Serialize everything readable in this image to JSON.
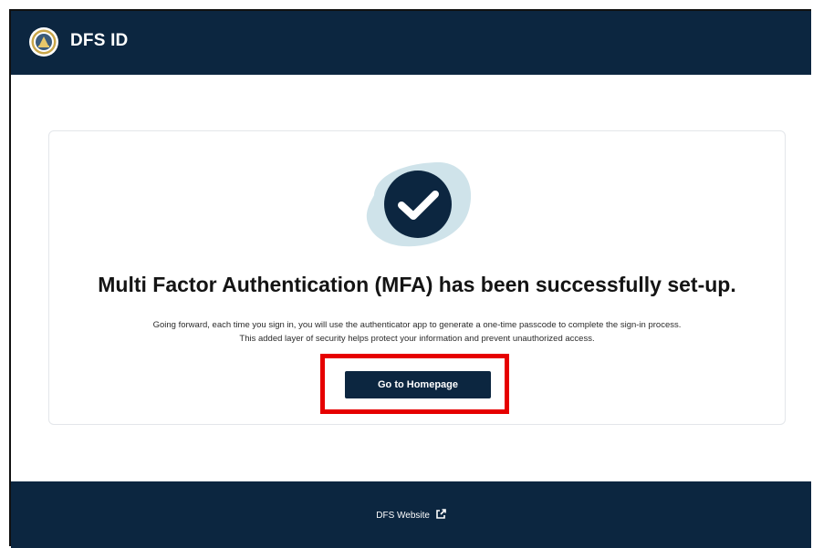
{
  "header": {
    "brand": "DFS ID",
    "logo_icon": "state-seal-icon"
  },
  "main": {
    "status_icon": "checkmark-circle-icon",
    "title": "Multi Factor Authentication (MFA) has been successfully set-up.",
    "description_line1": "Going forward, each time you sign in, you will use the authenticator app to generate a one-time passcode to complete the sign-in process.",
    "description_line2": "This added layer of security helps protect your information and prevent unauthorized access.",
    "primary_button": "Go to Homepage"
  },
  "footer": {
    "link_label": "DFS Website",
    "link_icon": "external-link-icon"
  },
  "colors": {
    "brand_navy": "#0c2640",
    "check_blob": "#cfe3ea",
    "highlight": "#e60000"
  }
}
